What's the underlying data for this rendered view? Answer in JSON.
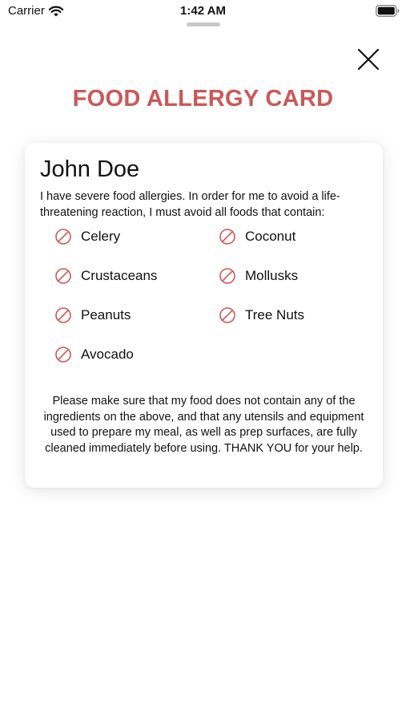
{
  "status_bar": {
    "carrier": "Carrier",
    "time": "1:42 AM",
    "wifi_icon": "wifi-icon",
    "battery_icon": "battery-icon"
  },
  "header": {
    "title": "FOOD ALLERGY CARD",
    "close_icon": "close-icon"
  },
  "card": {
    "name": "John Doe",
    "intro": "I have severe food allergies. In order for me to avoid a life-threatening reaction, I must avoid all foods that contain:",
    "allergens": [
      {
        "label": "Celery",
        "icon": "prohibited-icon"
      },
      {
        "label": "Coconut",
        "icon": "prohibited-icon"
      },
      {
        "label": "Crustaceans",
        "icon": "prohibited-icon"
      },
      {
        "label": "Mollusks",
        "icon": "prohibited-icon"
      },
      {
        "label": "Peanuts",
        "icon": "prohibited-icon"
      },
      {
        "label": "Tree Nuts",
        "icon": "prohibited-icon"
      },
      {
        "label": "Avocado",
        "icon": "prohibited-icon"
      }
    ],
    "closing": "Please make sure that my food does not contain any of the ingredients on the above, and that any utensils and equipment used to prepare my meal, as well as prep surfaces, are fully cleaned immediately before using. THANK YOU for your help."
  },
  "colors": {
    "accent": "#cc5757",
    "text": "#111111",
    "background": "#ffffff"
  }
}
